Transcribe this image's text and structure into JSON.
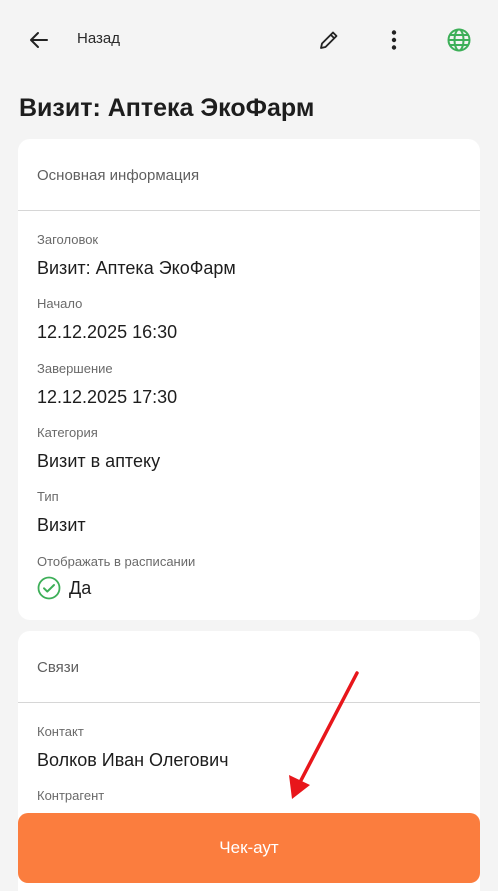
{
  "header": {
    "back_label": "Назад",
    "page_title": "Визит: Аптека ЭкоФарм",
    "icons": [
      "arrow-left-icon",
      "pencil-icon",
      "more-vertical-icon",
      "globe-icon"
    ]
  },
  "info_card": {
    "section_title": "Основная информация",
    "fields": [
      {
        "label": "Заголовок",
        "value": "Визит: Аптека ЭкоФарм"
      },
      {
        "label": "Начало",
        "value": "12.12.2025 16:30"
      },
      {
        "label": "Завершение",
        "value": "12.12.2025 17:30"
      },
      {
        "label": "Категория",
        "value": "Визит в аптеку"
      },
      {
        "label": "Тип",
        "value": "Визит"
      }
    ],
    "show_in_schedule": {
      "label": "Отображать в расписании",
      "value": "Да"
    }
  },
  "links_card": {
    "section_title": "Связи",
    "fields": [
      {
        "label": "Контакт",
        "value": "Волков Иван Олегович"
      },
      {
        "label": "Контрагент",
        "value": ""
      }
    ]
  },
  "actions": {
    "checkout_label": "Чек-аут"
  },
  "colors": {
    "accent": "#fb7d3e",
    "check_green": "#3daf58",
    "globe_green": "#3daf58",
    "annotation_red": "#e8161b"
  }
}
